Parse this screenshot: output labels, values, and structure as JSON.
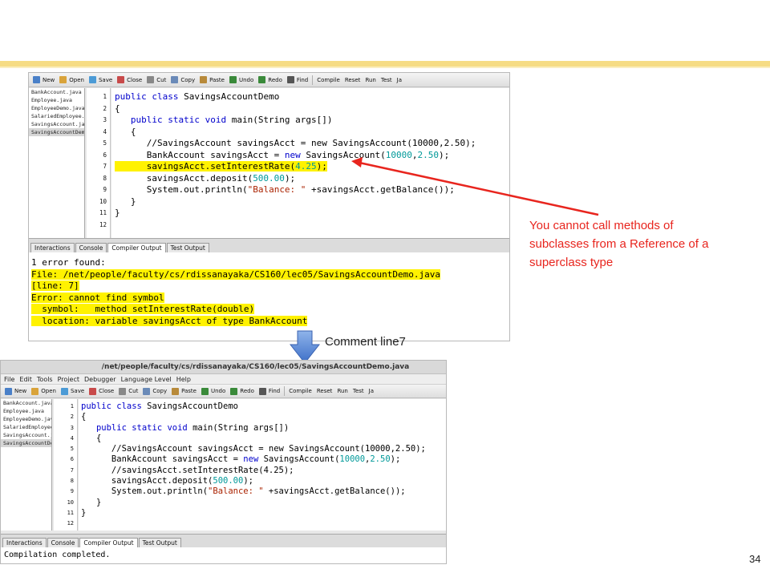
{
  "slide": {
    "page_number": "34",
    "annotation_lines": [
      "You cannot call methods of",
      "subclasses from a Reference of a",
      "superclass type"
    ],
    "comment_label": "Comment line7",
    "accent_stripe_color": "#f6dc84",
    "annotation_color": "#e8251e"
  },
  "top_ide": {
    "toolbar": [
      "New",
      "Open",
      "Save",
      "Close",
      "Cut",
      "Copy",
      "Paste",
      "Undo",
      "Redo",
      "Find",
      "Compile",
      "Reset",
      "Run",
      "Test",
      "Ja"
    ],
    "files": [
      "BankAccount.java",
      "Employee.java",
      "EmployeeDemo.java",
      "SalariedEmployee.j",
      "SavingsAccount.jav",
      "SavingsAccountDemo"
    ],
    "line_numbers": [
      "1",
      "2",
      "3",
      "4",
      "5",
      "6",
      "7",
      "8",
      "9",
      "10",
      "11",
      "12"
    ],
    "tabs": [
      "Interactions",
      "Console",
      "Compiler Output",
      "Test Output"
    ],
    "output_lines": [
      "1 error found:",
      "File: /net/people/faculty/cs/rdissanayaka/CS160/lec05/SavingsAccountDemo.java",
      "[line: 7]",
      "Error: cannot find symbol",
      "  symbol:   method setInterestRate(double)",
      "  location: variable savingsAcct of type BankAccount"
    ],
    "code": {
      "l1_kw": "public class",
      "l1_rest": " SavingsAccountDemo",
      "l2": "{",
      "l3_kw": "   public static void",
      "l3_rest": " main(String args[])",
      "l4": "   {",
      "l5": "      //SavingsAccount savingsAcct = new SavingsAccount(10000,2.50);",
      "l6_a": "      BankAccount savingsAcct = ",
      "l6_kw": "new",
      "l6_b": " SavingsAccount(",
      "l6_n1": "10000",
      "l6_c": ",",
      "l6_n2": "2.50",
      "l6_d": ");",
      "l7_a": "      savingsAcct.setInterestRate(",
      "l7_n": "4.25",
      "l7_b": ");",
      "l8_a": "      savingsAcct.deposit(",
      "l8_n": "500.00",
      "l8_b": ");",
      "l9_a": "      System.out.println(",
      "l9_s": "\"Balance: \"",
      "l9_b": " +savingsAcct.getBalance());",
      "l10": "   }",
      "l11": "}",
      "l12": ""
    }
  },
  "bottom_ide": {
    "title": "/net/people/faculty/cs/rdissanayaka/CS160/lec05/SavingsAccountDemo.java",
    "menu": [
      "File",
      "Edit",
      "Tools",
      "Project",
      "Debugger",
      "Language Level",
      "Help"
    ],
    "toolbar": [
      "New",
      "Open",
      "Save",
      "Close",
      "Cut",
      "Copy",
      "Paste",
      "Undo",
      "Redo",
      "Find",
      "Compile",
      "Reset",
      "Run",
      "Test",
      "Ja"
    ],
    "files": [
      "BankAccount.java",
      "Employee.java",
      "EmployeeDemo.java",
      "SalariedEmployee.j",
      "SavingsAccount.jav",
      "SavingsAccountDemo"
    ],
    "line_numbers": [
      "1",
      "2",
      "3",
      "4",
      "5",
      "6",
      "7",
      "8",
      "9",
      "10",
      "11",
      "12"
    ],
    "tabs": [
      "Interactions",
      "Console",
      "Compiler Output",
      "Test Output"
    ],
    "output_text": "Compilation completed.",
    "code": {
      "l1_kw": "public class",
      "l1_rest": " SavingsAccountDemo",
      "l2": "{",
      "l3_kw": "   public static void",
      "l3_rest": " main(String args[])",
      "l4": "   {",
      "l5": "      //SavingsAccount savingsAcct = new SavingsAccount(10000,2.50);",
      "l6_a": "      BankAccount savingsAcct = ",
      "l6_kw": "new",
      "l6_b": " SavingsAccount(",
      "l6_n1": "10000",
      "l6_c": ",",
      "l6_n2": "2.50",
      "l6_d": ");",
      "l7": "      //savingsAcct.setInterestRate(4.25);",
      "l8_a": "      savingsAcct.deposit(",
      "l8_n": "500.00",
      "l8_b": ");",
      "l9_a": "      System.out.println(",
      "l9_s": "\"Balance: \"",
      "l9_b": " +savingsAcct.getBalance());",
      "l10": "   }",
      "l11": "}"
    }
  }
}
